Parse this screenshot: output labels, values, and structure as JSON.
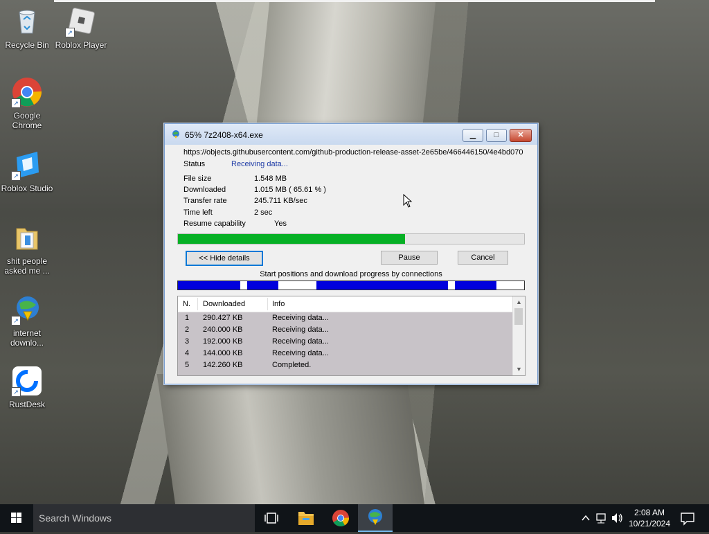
{
  "desktop": {
    "icons": [
      {
        "label": "Recycle Bin"
      },
      {
        "label": "Roblox Player"
      },
      {
        "label": "Google Chrome"
      },
      {
        "label": "Roblox Studio"
      },
      {
        "label": "shit people asked me ..."
      },
      {
        "label": "internet downlo..."
      },
      {
        "label": "RustDesk"
      }
    ]
  },
  "window": {
    "title": "65% 7z2408-x64.exe",
    "url": "https://objects.githubusercontent.com/github-production-release-asset-2e65be/466446150/4e4bd070",
    "status_label": "Status",
    "status_value": "Receiving data...",
    "fields": [
      {
        "label": "File size",
        "value": "1.548  MB"
      },
      {
        "label": "Downloaded",
        "value": "1.015  MB  ( 65.61 % )"
      },
      {
        "label": "Transfer rate",
        "value": "245.711  KB/sec"
      },
      {
        "label": "Time left",
        "value": "2 sec"
      },
      {
        "label": "Resume capability",
        "value": "Yes"
      }
    ],
    "progress_fraction": 0.6561,
    "buttons": {
      "hide_details": "<< Hide details",
      "pause": "Pause",
      "cancel": "Cancel"
    },
    "connections_caption": "Start positions and download progress by connections",
    "connections_progress": [
      0.9,
      0.45,
      1.0,
      0.9,
      0.6
    ],
    "table": {
      "headers": [
        "N.",
        "Downloaded",
        "Info"
      ],
      "rows": [
        {
          "n": "1",
          "downloaded": "290.427  KB",
          "info": "Receiving data..."
        },
        {
          "n": "2",
          "downloaded": "240.000  KB",
          "info": "Receiving data..."
        },
        {
          "n": "3",
          "downloaded": "192.000  KB",
          "info": "Receiving data..."
        },
        {
          "n": "4",
          "downloaded": "144.000  KB",
          "info": "Receiving data..."
        },
        {
          "n": "5",
          "downloaded": "142.260  KB",
          "info": "Completed."
        }
      ]
    }
  },
  "taskbar": {
    "search_placeholder": "Search Windows",
    "clock_time": "2:08 AM",
    "clock_date": "10/21/2024"
  },
  "colors": {
    "progress_green": "#06b025",
    "connection_blue": "#0000dd",
    "status_blue": "#1f3ca6",
    "taskbar": "#101418"
  }
}
